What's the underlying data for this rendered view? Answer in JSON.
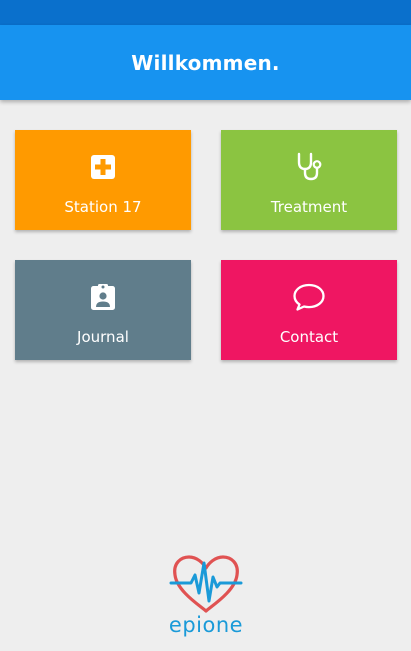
{
  "header": {
    "title": "Willkommen."
  },
  "tiles": [
    {
      "label": "Station 17",
      "icon": "medical-cross-icon",
      "color": "#ff9a00"
    },
    {
      "label": "Treatment",
      "icon": "stethoscope-icon",
      "color": "#8bc441"
    },
    {
      "label": "Journal",
      "icon": "clipboard-person-icon",
      "color": "#607d8b"
    },
    {
      "label": "Contact",
      "icon": "chat-bubble-icon",
      "color": "#ef1662"
    }
  ],
  "logo": {
    "text": "epione",
    "heart_color": "#e05252",
    "pulse_color": "#1a9ad8"
  },
  "colors": {
    "statusbar": "#0a70cc",
    "appbar": "#1793f0",
    "background": "#eeeeee"
  }
}
